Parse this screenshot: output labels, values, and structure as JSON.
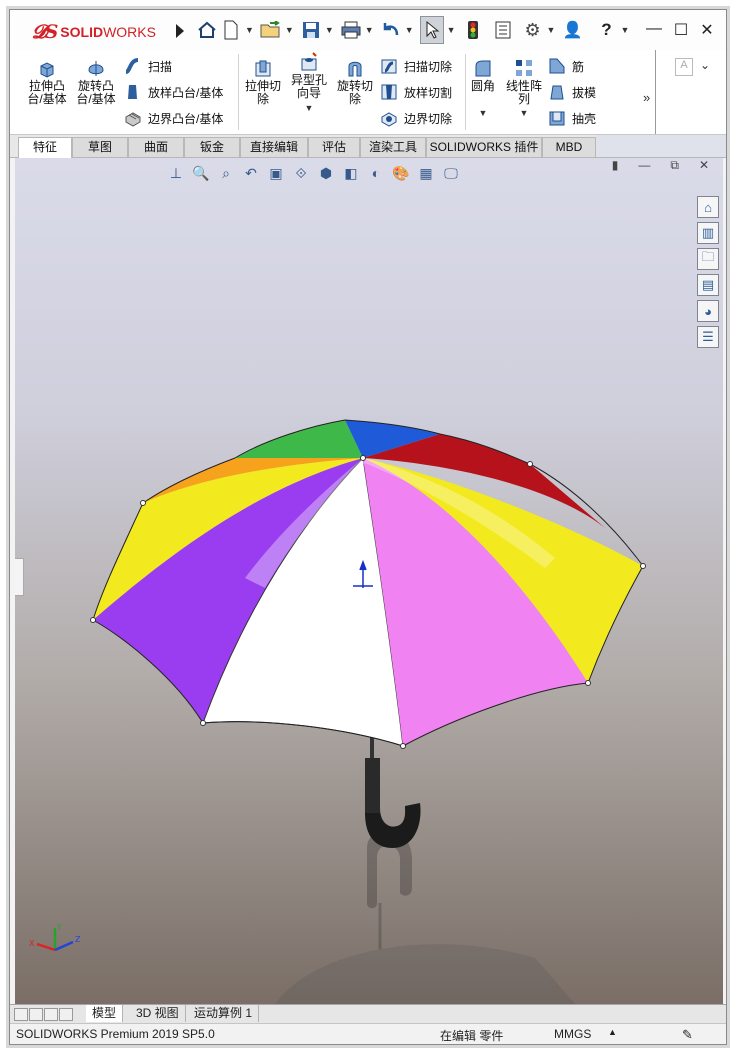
{
  "app": {
    "brand_prefix": "SOLID",
    "brand_suffix": "WORKS"
  },
  "ribbon": {
    "extrude_boss": "拉伸凸\n台/基体",
    "revolve_boss": "旋转凸\n台/基体",
    "sweep": "扫描",
    "loft_boss": "放样凸台/基体",
    "boundary_boss": "边界凸台/基体",
    "extrude_cut": "拉伸切\n除",
    "hole_wizard": "异型孔\n向导",
    "revolve_cut": "旋转切\n除",
    "swept_cut": "扫描切除",
    "lofted_cut": "放样切割",
    "boundary_cut": "边界切除",
    "fillet": "圆角",
    "linear_pattern": "线性阵\n列",
    "rib": "筋",
    "draft": "拔模",
    "shell": "抽壳"
  },
  "tabs": [
    "特征",
    "草图",
    "曲面",
    "钣金",
    "直接编辑",
    "评估",
    "渲染工具",
    "SOLIDWORKS 插件",
    "MBD"
  ],
  "active_tab": "特征",
  "bottom_tabs": [
    "模型",
    "3D 视图",
    "运动算例 1"
  ],
  "status": {
    "product": "SOLIDWORKS Premium 2019 SP5.0",
    "mode": "在编辑 零件",
    "units": "MMGS"
  },
  "colors": {
    "brand": "#d31f26",
    "panel_red": "#b5121b",
    "panel_yellow": "#f2ea1e",
    "panel_purple": "#9a3cf0",
    "panel_pink": "#f082f2",
    "panel_orange": "#f7a21c",
    "panel_green": "#3fb84a",
    "panel_blue": "#1f5bd9",
    "panel_white": "#ffffff"
  },
  "icons": [
    "home-icon",
    "new-document-icon",
    "open-icon",
    "save-icon",
    "print-icon",
    "undo-icon",
    "select-icon",
    "rebuild-icon",
    "file-properties-icon",
    "options-icon",
    "user-icon",
    "help-icon"
  ]
}
